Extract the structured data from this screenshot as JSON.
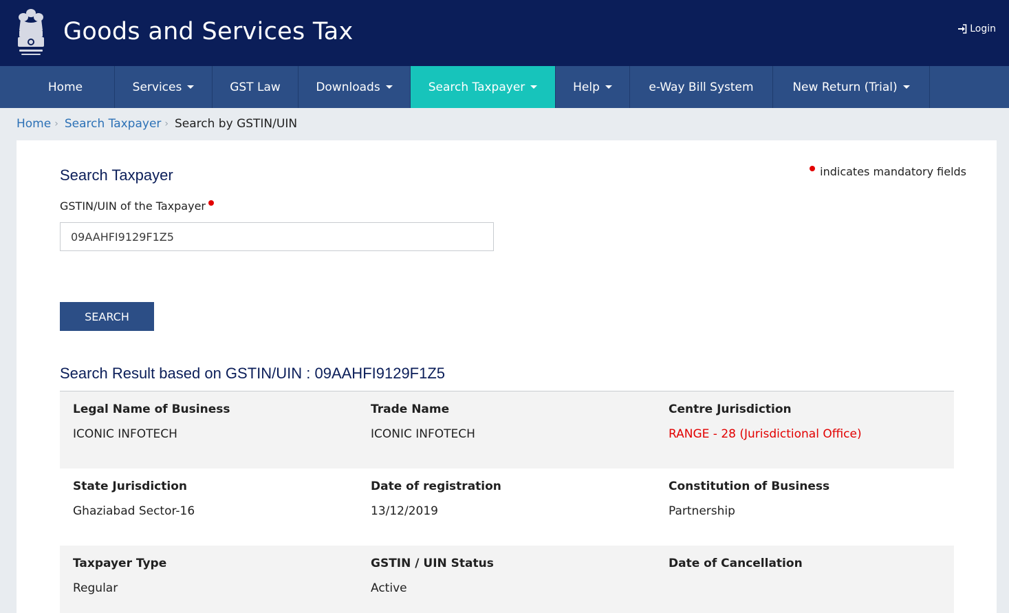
{
  "header": {
    "title": "Goods and Services Tax",
    "login_label": "Login",
    "login_icon": "sign-in-icon",
    "emblem_icon": "national-emblem-icon"
  },
  "nav": {
    "items": [
      {
        "label": "Home",
        "dropdown": false
      },
      {
        "label": "Services",
        "dropdown": true
      },
      {
        "label": "GST Law",
        "dropdown": false
      },
      {
        "label": "Downloads",
        "dropdown": true
      },
      {
        "label": "Search Taxpayer",
        "dropdown": true,
        "active": true
      },
      {
        "label": "Help",
        "dropdown": true
      },
      {
        "label": "e-Way Bill System",
        "dropdown": false
      },
      {
        "label": "New Return (Trial)",
        "dropdown": true
      }
    ]
  },
  "breadcrumb": {
    "home": "Home",
    "search_taxpayer": "Search Taxpayer",
    "current": "Search by GSTIN/UIN"
  },
  "form": {
    "section_title": "Search Taxpayer",
    "mandatory_note": "indicates mandatory fields",
    "field_label": "GSTIN/UIN of the Taxpayer",
    "field_value": "09AAHFI9129F1Z5",
    "search_button": "SEARCH"
  },
  "results": {
    "title": "Search Result based on GSTIN/UIN : 09AAHFI9129F1Z5",
    "rows": [
      [
        {
          "label": "Legal Name of Business",
          "value": "ICONIC INFOTECH"
        },
        {
          "label": "Trade Name",
          "value": "ICONIC INFOTECH"
        },
        {
          "label": "Centre Jurisdiction",
          "value": "RANGE - 28 (Jurisdictional Office)"
        }
      ],
      [
        {
          "label": "State Jurisdiction",
          "value": "Ghaziabad Sector-16"
        },
        {
          "label": "Date of registration",
          "value": "13/12/2019"
        },
        {
          "label": "Constitution of Business",
          "value": "Partnership"
        }
      ],
      [
        {
          "label": "Taxpayer Type",
          "value": "Regular"
        },
        {
          "label": "GSTIN / UIN Status",
          "value": "Active"
        },
        {
          "label": "Date of Cancellation",
          "value": ""
        }
      ]
    ]
  },
  "colors": {
    "header_bg": "#0b1e59",
    "nav_bg": "#2c4e86",
    "nav_active": "#17c4bb",
    "link": "#2c71b6",
    "mandatory": "#e20000"
  }
}
